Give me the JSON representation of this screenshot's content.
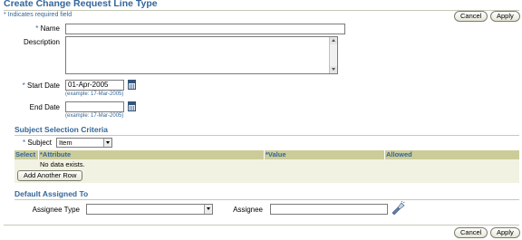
{
  "page": {
    "title": "Create Change Request Line Type",
    "required_note": "Indicates required field",
    "required_marker": "*",
    "accent_color": "#336699"
  },
  "buttons": {
    "cancel": "Cancel",
    "apply": "Apply"
  },
  "form": {
    "name_label": "Name",
    "name_value": "",
    "description_label": "Description",
    "description_value": "",
    "start_date_label": "Start Date",
    "start_date_value": "01-Apr-2005",
    "start_date_hint": "(example: 17-Mar-2005)",
    "end_date_label": "End Date",
    "end_date_value": "",
    "end_date_hint": "(example: 17-Mar-2005)",
    "calendar_icon": "calendar-icon"
  },
  "subject_section": {
    "heading": "Subject Selection Criteria",
    "subject_label": "Subject",
    "subject_value": "Item",
    "table": {
      "headers": {
        "select": "Select",
        "attribute": "Attribute",
        "value": "Value",
        "allowed": "Allowed"
      },
      "empty_message": "No data exists.",
      "add_row_label": "Add Another Row"
    }
  },
  "assign_section": {
    "heading": "Default Assigned To",
    "assignee_type_label": "Assignee Type",
    "assignee_type_value": "",
    "assignee_label": "Assignee",
    "assignee_value": "",
    "search_icon": "flashlight-search-icon"
  }
}
